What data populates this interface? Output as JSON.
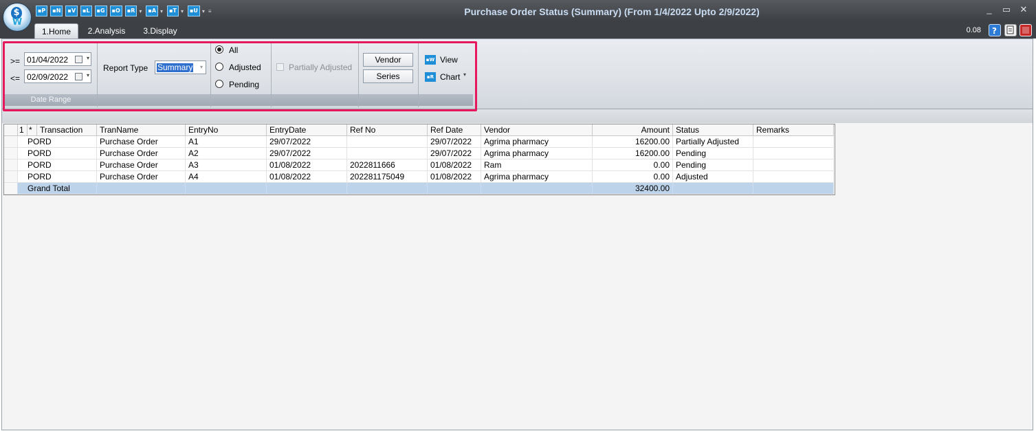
{
  "window": {
    "title": "Purchase Order Status (Summary)  (From 1/4/2022 Upto 2/9/2022)",
    "version": "0.08",
    "minimize": "_",
    "restore": "▭",
    "close": "✕"
  },
  "quick_access": [
    "P",
    "N",
    "V",
    "L",
    "G",
    "O",
    "R",
    "A",
    "T",
    "U"
  ],
  "tabs": [
    "1.Home",
    "2.Analysis",
    "3.Display"
  ],
  "date_range": {
    "from_op": ">=",
    "from": "01/04/2022",
    "to_op": "<=",
    "to": "02/09/2022",
    "caption": "Date Range"
  },
  "report_type": {
    "label": "Report Type",
    "value": "Summary"
  },
  "filter": {
    "all": "All",
    "adjusted": "Adjusted",
    "pending": "Pending",
    "selected": "All"
  },
  "partially_adjusted": "Partially Adjusted",
  "buttons": {
    "vendor": "Vendor",
    "series": "Series",
    "view": "View",
    "chart": "Chart"
  },
  "grid": {
    "corner_num": "1",
    "corner_star": "*",
    "columns": [
      "Transaction",
      "TranName",
      "EntryNo",
      "EntryDate",
      "Ref No",
      "Ref Date",
      "Vendor",
      "Amount",
      "Status",
      "Remarks"
    ],
    "rows": [
      {
        "transaction": "PORD",
        "tranname": "Purchase Order",
        "entryno": "A1",
        "entrydate": "29/07/2022",
        "refno": "",
        "refdate": "29/07/2022",
        "vendor": "Agrima pharmacy",
        "amount": "16200.00",
        "status": "Partially Adjusted",
        "remarks": ""
      },
      {
        "transaction": "PORD",
        "tranname": "Purchase Order",
        "entryno": "A2",
        "entrydate": "29/07/2022",
        "refno": "",
        "refdate": "29/07/2022",
        "vendor": "Agrima pharmacy",
        "amount": "16200.00",
        "status": "Pending",
        "remarks": ""
      },
      {
        "transaction": "PORD",
        "tranname": "Purchase Order",
        "entryno": "A3",
        "entrydate": "01/08/2022",
        "refno": "2022811666",
        "refdate": "01/08/2022",
        "vendor": "Ram",
        "amount": "0.00",
        "status": "Pending",
        "remarks": ""
      },
      {
        "transaction": "PORD",
        "tranname": "Purchase Order",
        "entryno": "A4",
        "entrydate": "01/08/2022",
        "refno": "202281175049",
        "refdate": "01/08/2022",
        "vendor": "Agrima pharmacy",
        "amount": "0.00",
        "status": "Adjusted",
        "remarks": ""
      }
    ],
    "total": {
      "label": "Grand Total",
      "amount": "32400.00"
    }
  },
  "colors": {
    "highlight": "#e6175b",
    "total_row": "#bcd3ea",
    "title_text": "#c9dcf2"
  }
}
